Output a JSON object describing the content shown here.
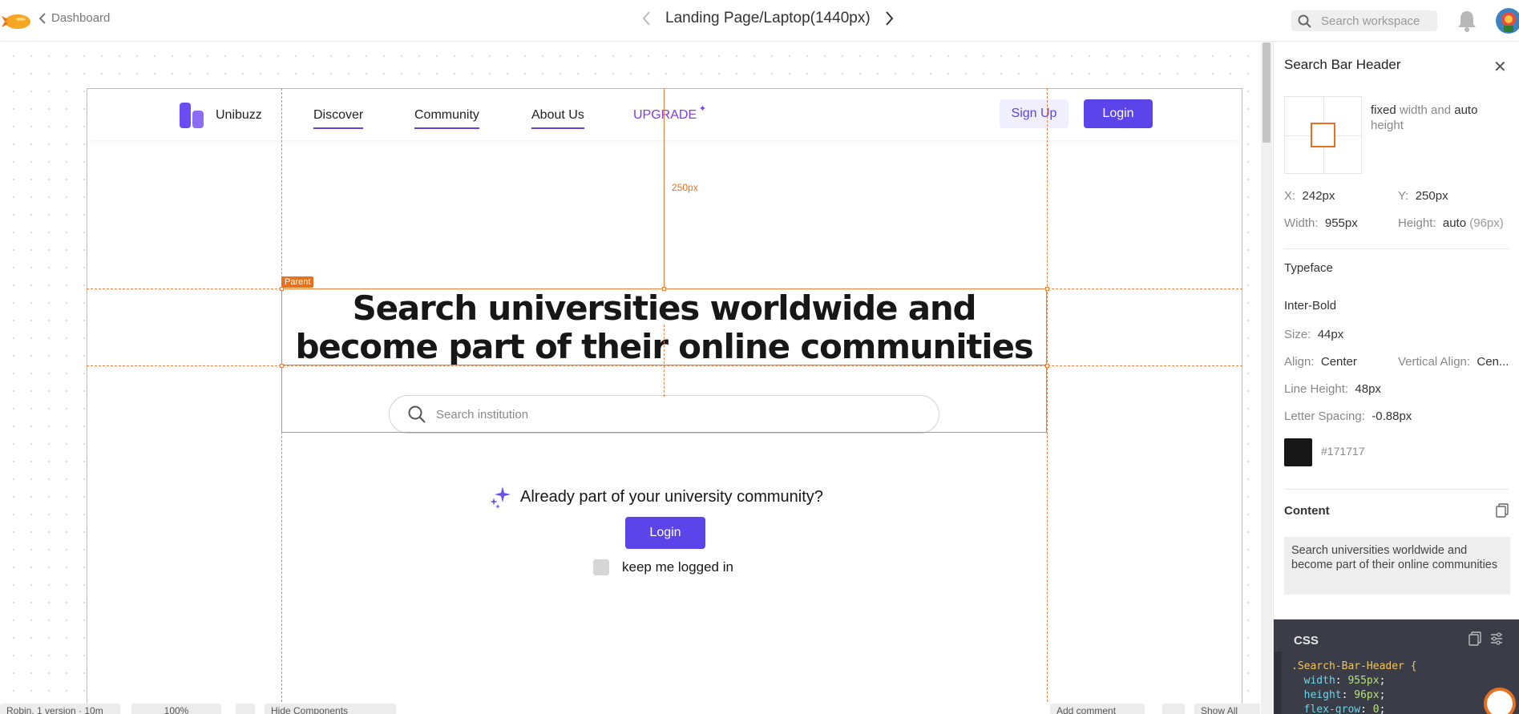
{
  "topbar": {
    "back_label": "Dashboard",
    "page_title": "Landing Page/Laptop(1440px)",
    "search_placeholder": "Search workspace"
  },
  "frame": {
    "brand": "Unibuzz",
    "nav_links": [
      "Discover",
      "Community",
      "About Us"
    ],
    "upgrade_label": "UPGRADE",
    "upgrade_star": "✦",
    "signup_label": "Sign Up",
    "login_label": "Login",
    "headline": "Search universities worldwide and become part of their online communities",
    "search_placeholder": "Search institution",
    "already_text": "Already part of your university community?",
    "login_button": "Login",
    "keep_logged_in": "keep me logged in"
  },
  "overlay": {
    "parent_tag": "Parent",
    "measure": "250px"
  },
  "bottom_bar": {
    "versions": "Robin, 1 version · 10m",
    "zoom": "100%",
    "hide_components": "Hide Components",
    "add_comment": "Add comment",
    "show_all": "Show All"
  },
  "inspector": {
    "title": "Search Bar Header",
    "sizing_fixed": "fixed",
    "sizing_mid": " width and ",
    "sizing_auto": "auto",
    "sizing_end": " height",
    "x_label": "X:",
    "x_value": "242px",
    "y_label": "Y:",
    "y_value": "250px",
    "width_label": "Width:",
    "width_value": "955px",
    "height_label": "Height:",
    "height_value": "auto",
    "height_computed": "(96px)",
    "typeface_title": "Typeface",
    "font_name": "Inter-Bold",
    "size_label": "Size:",
    "size_value": "44px",
    "align_label": "Align:",
    "align_value": "Center",
    "valign_label": "Vertical Align:",
    "valign_value": "Cen...",
    "lineheight_label": "Line Height:",
    "lineheight_value": "48px",
    "letterspacing_label": "Letter Spacing:",
    "letterspacing_value": "-0.88px",
    "color_hex": "#171717",
    "content_title": "Content",
    "content_text": "Search universities worldwide and become part of their online communities",
    "css_title": "CSS",
    "css_selector": ".Search-Bar-Header {",
    "css_width_prop": "width",
    "css_width_val": "955px",
    "css_height_prop": "height",
    "css_height_val": "96px",
    "css_flex_prop": "flex-grow",
    "css_flex_val": "0"
  },
  "colors": {
    "accent": "#5b44ea",
    "guide": "#f08040",
    "text": "#171717"
  }
}
